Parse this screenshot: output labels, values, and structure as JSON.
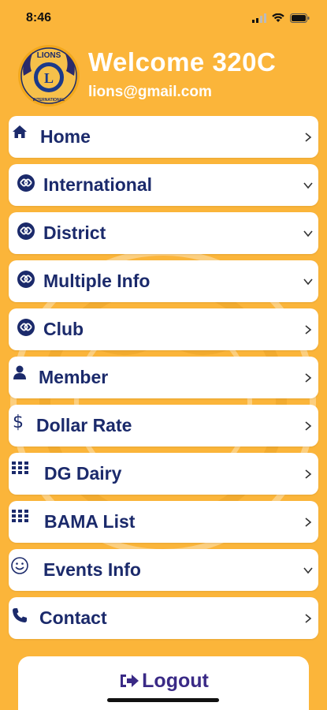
{
  "status_bar": {
    "time": "8:46"
  },
  "header": {
    "welcome_text": "Welcome 320C",
    "email": "lions@gmail.com",
    "logo_top_text": "LIONS",
    "logo_letter": "L",
    "logo_bottom_text": "INTERNATIONAL"
  },
  "menu": {
    "items": [
      {
        "label": "Home",
        "icon": "home-icon",
        "chevron": "right"
      },
      {
        "label": "International",
        "icon": "lions-circle-icon",
        "chevron": "down"
      },
      {
        "label": "District",
        "icon": "lions-circle-icon",
        "chevron": "down"
      },
      {
        "label": "Multiple Info",
        "icon": "lions-circle-icon",
        "chevron": "down"
      },
      {
        "label": "Club",
        "icon": "lions-circle-icon",
        "chevron": "right"
      },
      {
        "label": "Member",
        "icon": "person-icon",
        "chevron": "right"
      },
      {
        "label": "Dollar Rate",
        "icon": "dollar-icon",
        "chevron": "right"
      },
      {
        "label": "DG Dairy",
        "icon": "grid-icon",
        "chevron": "right"
      },
      {
        "label": "BAMA List",
        "icon": "grid-icon",
        "chevron": "right"
      },
      {
        "label": "Events Info",
        "icon": "smiley-icon",
        "chevron": "down"
      },
      {
        "label": "Contact",
        "icon": "phone-icon",
        "chevron": "right"
      }
    ]
  },
  "logout": {
    "label": "Logout",
    "icon": "sign-out-icon"
  },
  "colors": {
    "background": "#fbb53a",
    "menu_text": "#1b2a6b",
    "logout_text": "#3a2a86",
    "card": "#ffffff"
  }
}
